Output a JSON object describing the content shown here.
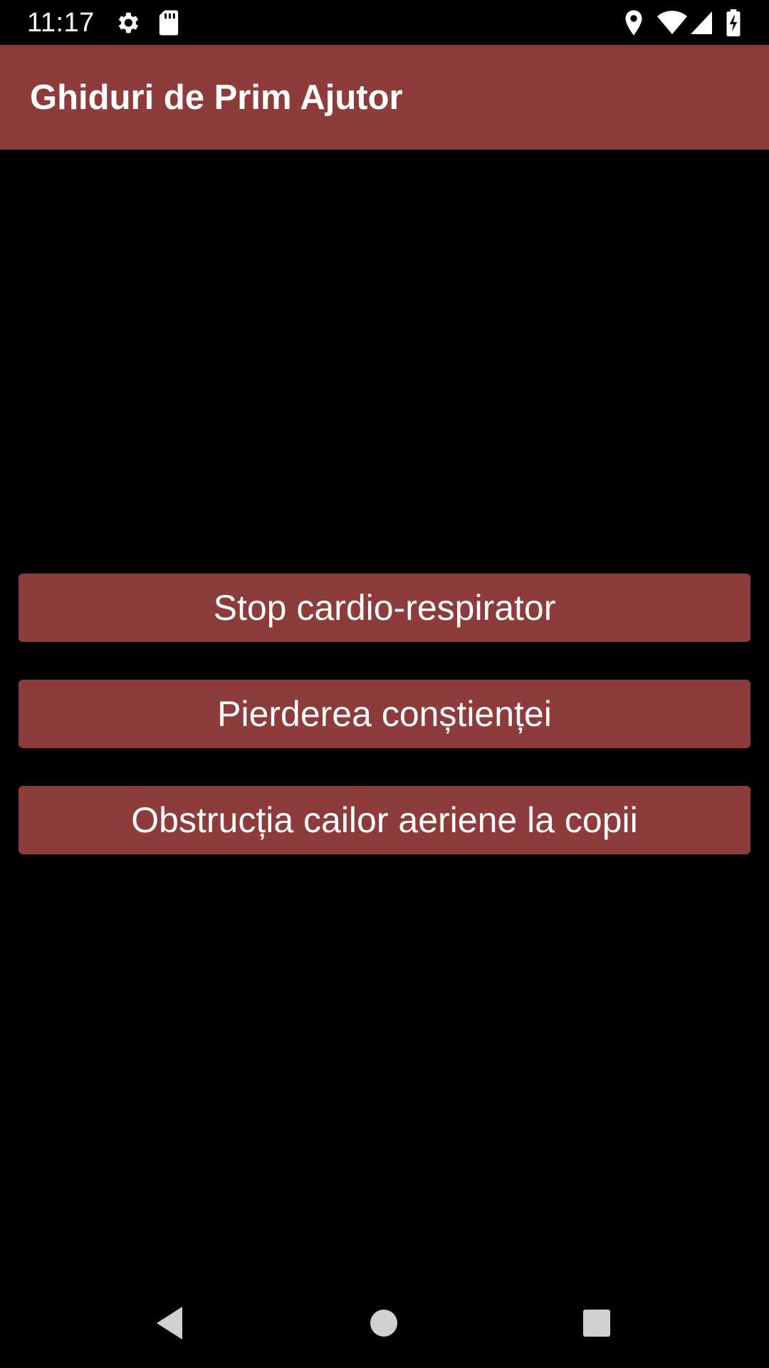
{
  "status_bar": {
    "time": "11:17",
    "left_icons": [
      "settings-gear-icon",
      "sd-card-icon"
    ],
    "right_icons": [
      "location-pin-icon",
      "wifi-icon",
      "cell-signal-icon",
      "battery-charging-icon"
    ]
  },
  "app_bar": {
    "title": "Ghiduri de Prim Ajutor",
    "color": "#8e3b3b"
  },
  "guides": [
    {
      "label": "Stop cardio-respirator"
    },
    {
      "label": "Pierderea conștienței"
    },
    {
      "label": "Obstrucția cailor aeriene la copii"
    }
  ],
  "nav_bar": {
    "buttons": [
      "back-icon",
      "home-icon",
      "recents-icon"
    ]
  },
  "colors": {
    "accent": "#8e3b3b",
    "background": "#000000",
    "text": "#ffffff"
  }
}
